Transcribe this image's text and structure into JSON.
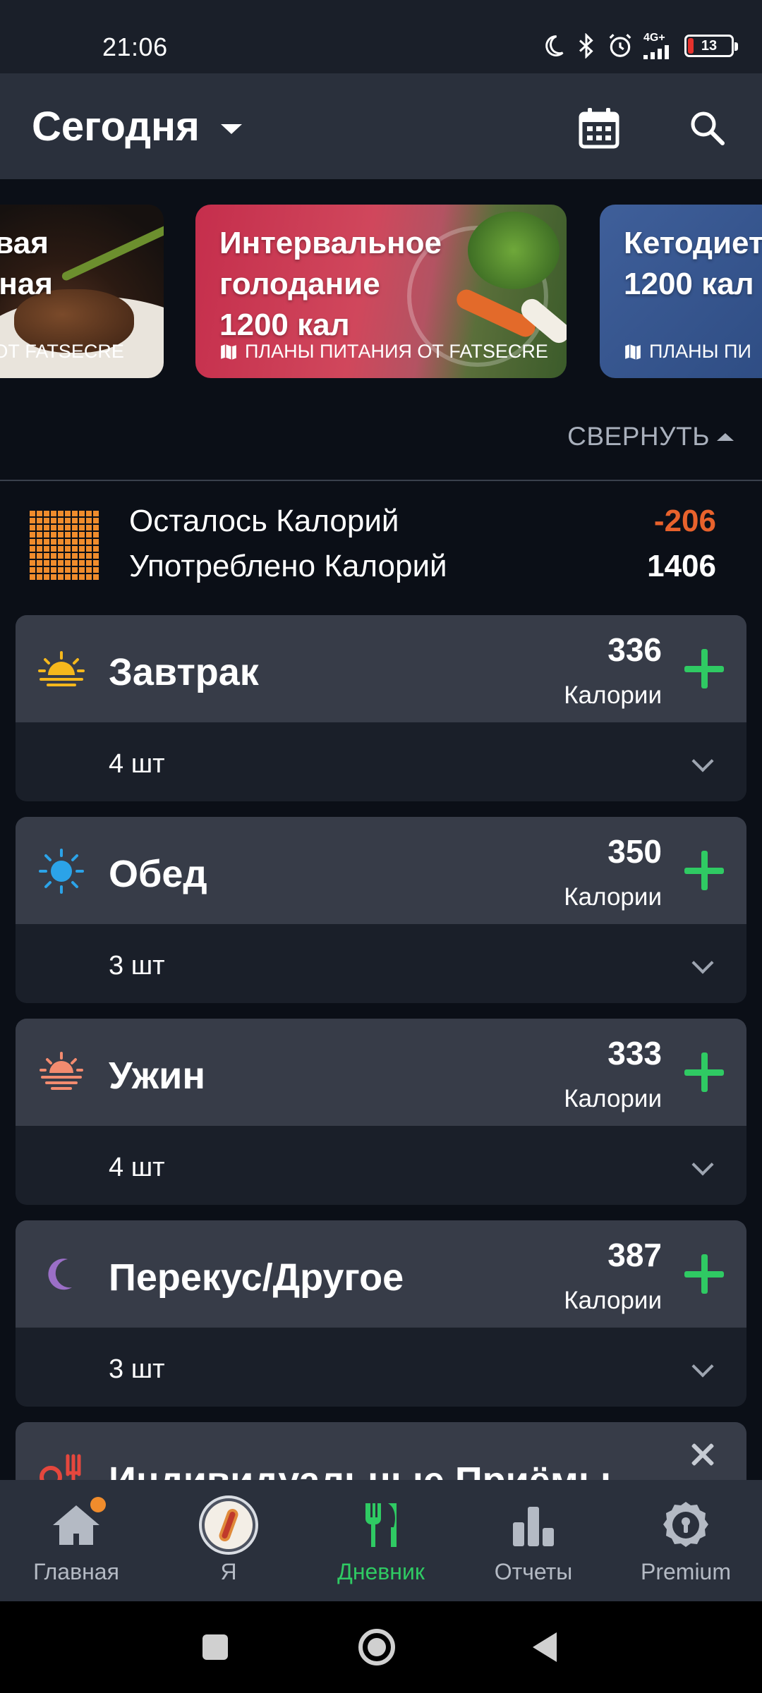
{
  "status": {
    "time": "21:06",
    "network": "4G+",
    "battery": "13"
  },
  "appbar": {
    "title": "Сегодня"
  },
  "carousel": {
    "cards": [
      {
        "title_line1": "ковая",
        "title_line2": "одная",
        "source": "ИЯ ОТ FATSECRE"
      },
      {
        "title_line1": "Интервальное",
        "title_line2": "голодание",
        "title_line3": "1200 кал",
        "source": "ПЛАНЫ ПИТАНИЯ ОТ FATSECRE"
      },
      {
        "title_line1": "Кетодиет",
        "title_line2": "1200 кал",
        "source": "ПЛАНЫ ПИ"
      }
    ],
    "collapse_label": "СВЕРНУТЬ"
  },
  "summary": {
    "remaining_label": "Осталось Калорий",
    "remaining_value": "-206",
    "consumed_label": "Употреблено Калорий",
    "consumed_value": "1406"
  },
  "meals": [
    {
      "name": "Завтрак",
      "calories": "336",
      "calories_label": "Калории",
      "count": "4 шт",
      "icon": "sunrise-icon"
    },
    {
      "name": "Обед",
      "calories": "350",
      "calories_label": "Калории",
      "count": "3 шт",
      "icon": "sun-icon"
    },
    {
      "name": "Ужин",
      "calories": "333",
      "calories_label": "Калории",
      "count": "4 шт",
      "icon": "sunset-icon"
    },
    {
      "name": "Перекус/Другое",
      "calories": "387",
      "calories_label": "Калории",
      "count": "3 шт",
      "icon": "moon-icon"
    }
  ],
  "custom_meals": {
    "title": "Индивидуальные Приёмы"
  },
  "nav": {
    "home": "Главная",
    "me": "Я",
    "diary": "Дневник",
    "reports": "Отчеты",
    "premium": "Premium"
  },
  "colors": {
    "accent_green": "#2fca63",
    "accent_orange": "#f08c2c",
    "negative": "#e8622c"
  }
}
